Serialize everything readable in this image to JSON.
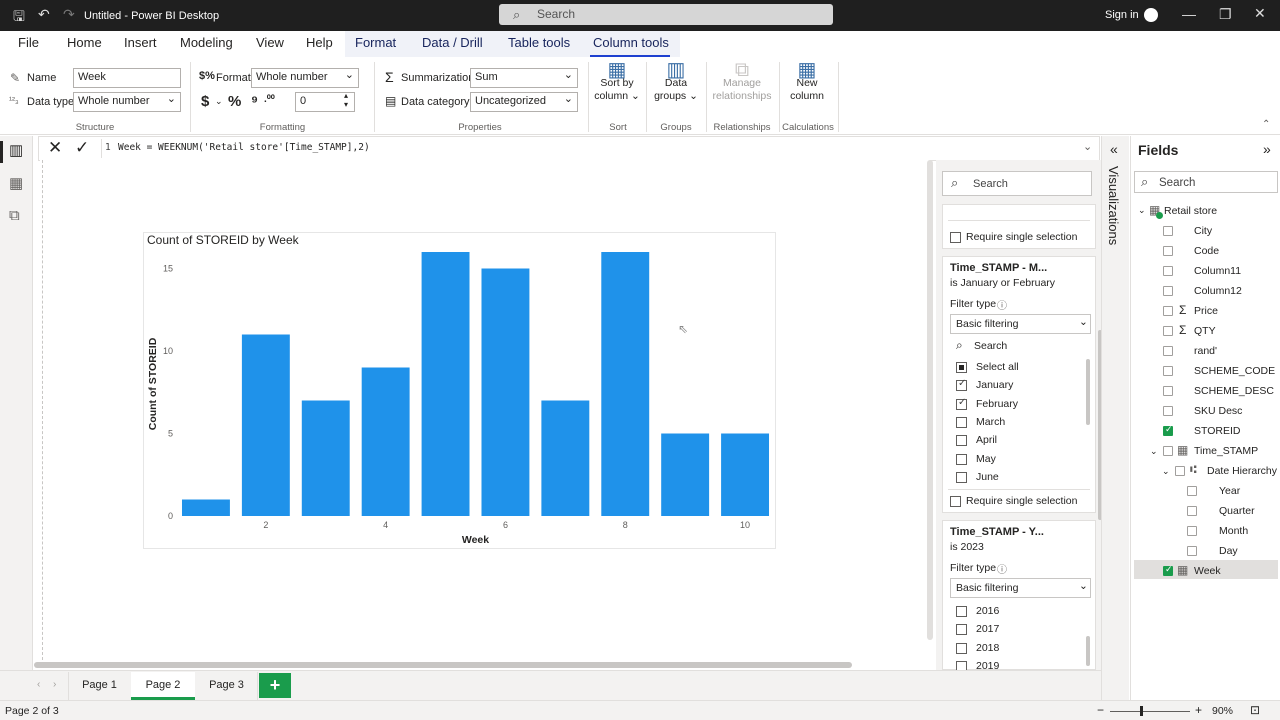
{
  "titlebar": {
    "title": "Untitled - Power BI Desktop",
    "search_placeholder": "Search",
    "signin": "Sign in"
  },
  "menu": {
    "items": [
      "File",
      "Home",
      "Insert",
      "Modeling",
      "View",
      "Help"
    ],
    "context": [
      "Format",
      "Data / Drill",
      "Table tools",
      "Column tools"
    ],
    "active": "Column tools"
  },
  "ribbon": {
    "structure": {
      "name_label": "Name",
      "name_value": "Week",
      "datatype_label": "Data type",
      "datatype_value": "Whole number",
      "group": "Structure"
    },
    "formatting": {
      "format_label": "Format",
      "format_value": "Whole number",
      "decimals_value": "0",
      "group": "Formatting"
    },
    "properties": {
      "summarization_label": "Summarization",
      "summarization_value": "Sum",
      "category_label": "Data category",
      "category_value": "Uncategorized",
      "group": "Properties"
    },
    "sort": {
      "label1": "Sort by",
      "label2": "column",
      "group": "Sort"
    },
    "groups": {
      "label1": "Data",
      "label2": "groups",
      "group": "Groups"
    },
    "relationships": {
      "label1": "Manage",
      "label2": "relationships",
      "group": "Relationships"
    },
    "calculations": {
      "label1": "New",
      "label2": "column",
      "group": "Calculations"
    }
  },
  "formula": {
    "line": "1",
    "text": "Week = WEEKNUM('Retail store'[Time_STAMP],2)"
  },
  "chart_data": {
    "type": "bar",
    "title": "Count of STOREID by Week",
    "xlabel": "Week",
    "ylabel": "Count of STOREID",
    "categories": [
      1,
      2,
      3,
      4,
      5,
      6,
      7,
      8,
      9,
      10
    ],
    "values": [
      1,
      11,
      7,
      9,
      16,
      15,
      7,
      16,
      5,
      5
    ],
    "ylim": [
      0,
      16
    ],
    "yticks": [
      0,
      5,
      10,
      15
    ],
    "xticks": [
      2,
      4,
      6,
      8,
      10
    ],
    "color": "#1f92ea"
  },
  "filters": {
    "search_placeholder": "Search",
    "require_single": "Require single selection",
    "card1": {
      "title": "Time_STAMP - M...",
      "subtitle": "is January or February",
      "filter_type_label": "Filter type",
      "filter_type_value": "Basic filtering",
      "search_placeholder": "Search",
      "items": [
        {
          "label": "Select all",
          "state": "partial"
        },
        {
          "label": "January",
          "state": "on"
        },
        {
          "label": "February",
          "state": "on"
        },
        {
          "label": "March",
          "state": "off"
        },
        {
          "label": "April",
          "state": "off"
        },
        {
          "label": "May",
          "state": "off"
        },
        {
          "label": "June",
          "state": "off"
        }
      ],
      "require_single": "Require single selection"
    },
    "card2": {
      "title": "Time_STAMP - Y...",
      "subtitle": "is 2023",
      "filter_type_label": "Filter type",
      "filter_type_value": "Basic filtering",
      "items": [
        "2016",
        "2017",
        "2018",
        "2019"
      ]
    }
  },
  "visualizations_label": "Visualizations",
  "fields": {
    "title": "Fields",
    "search_placeholder": "Search",
    "table": "Retail store",
    "items": [
      {
        "label": "City",
        "checked": false,
        "sigma": false
      },
      {
        "label": "Code",
        "checked": false,
        "sigma": false
      },
      {
        "label": "Column11",
        "checked": false,
        "sigma": false
      },
      {
        "label": "Column12",
        "checked": false,
        "sigma": false
      },
      {
        "label": "Price",
        "checked": false,
        "sigma": true
      },
      {
        "label": "QTY",
        "checked": false,
        "sigma": true
      },
      {
        "label": "rand'",
        "checked": false,
        "sigma": false
      },
      {
        "label": "SCHEME_CODE",
        "checked": false,
        "sigma": false
      },
      {
        "label": "SCHEME_DESC",
        "checked": false,
        "sigma": false
      },
      {
        "label": "SKU Desc",
        "checked": false,
        "sigma": false
      },
      {
        "label": "STOREID",
        "checked": true,
        "sigma": false
      }
    ],
    "time_stamp": "Time_STAMP",
    "date_hierarchy": "Date Hierarchy",
    "hierarchy_items": [
      "Year",
      "Quarter",
      "Month",
      "Day"
    ],
    "week": "Week"
  },
  "pages": {
    "tabs": [
      "Page 1",
      "Page 2",
      "Page 3"
    ],
    "active": "Page 2",
    "add": "+"
  },
  "status": {
    "page_info": "Page 2 of 3",
    "zoom": "90%"
  }
}
